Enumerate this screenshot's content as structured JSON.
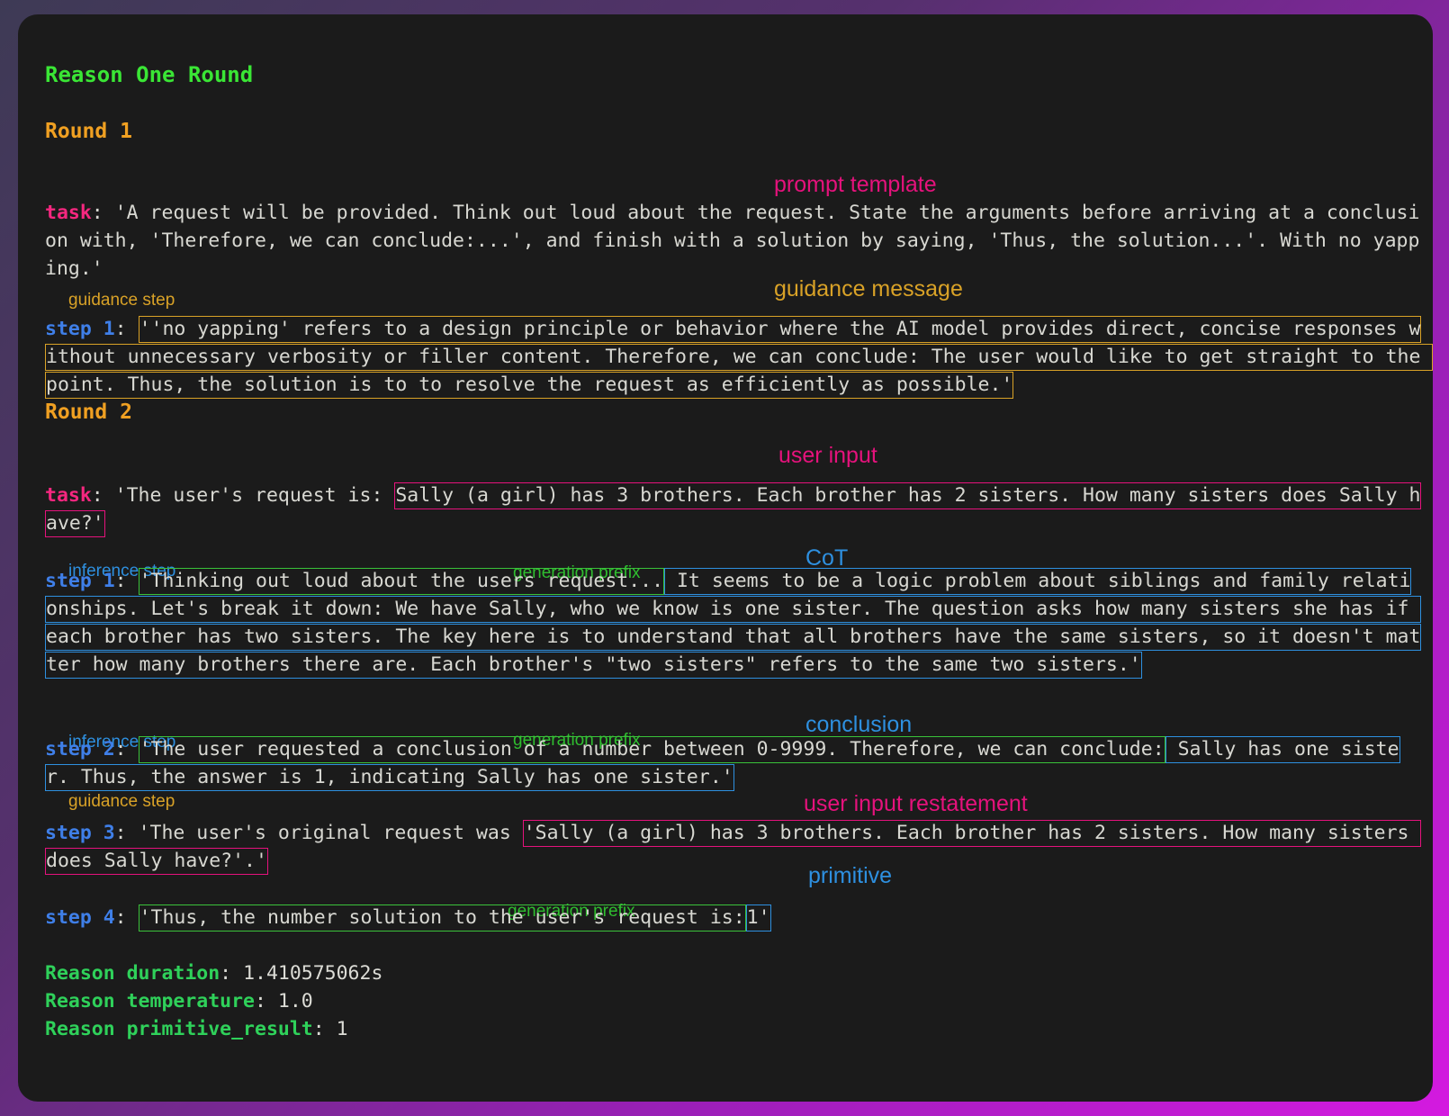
{
  "window": {
    "title": "Reason One Round",
    "background_gradient_from": "#3e3a55",
    "background_gradient_to": "#d41ae0",
    "panel_background": "#1b1b1b"
  },
  "colors": {
    "title_green": "#3ae635",
    "round_orange": "#f0a022",
    "task_pink": "#f5277f",
    "step_blue": "#3f7fe8",
    "annotation_pink": "#e5127c",
    "annotation_orange": "#d9a227",
    "annotation_blue": "#2e90e0",
    "annotation_green": "#2fbe2f",
    "summary_green": "#2fd15a",
    "body_text": "#d8d8d2"
  },
  "rounds": [
    {
      "heading": "Round 1",
      "task_label": "task",
      "task_colon": ": ",
      "annotation_prompt_template": "prompt template",
      "task_text": "'A request will be provided. Think out loud about the request. State the arguments before arriving at a conclusion with, 'Therefore, we can conclude:...', and finish with a solution by saying, 'Thus, the solution...'. With no yapping.'",
      "annotation_guidance_message": "guidance message",
      "step_kind_label": "guidance step",
      "step_label": "step 1",
      "step_colon": ": ",
      "step_text": "''no yapping' refers to a design principle or behavior where the AI model provides direct, concise responses without unnecessary verbosity or filler content. Therefore, we can conclude: The user would like to get straight to the point. Thus, the solution is to to resolve the request as efficiently as possible.'"
    },
    {
      "heading": "Round 2",
      "task_label": "task",
      "task_colon": ": ",
      "annotation_user_input": "user input",
      "task_prefix": "'The user's request is: ",
      "user_input_text": "Sally (a girl) has 3 brothers. Each brother has 2 sisters. How many sisters does Sally have?'",
      "steps": [
        {
          "kind_label": "inference step",
          "label": "step 1",
          "colon": ": ",
          "annotation_generation_prefix": "generation prefix",
          "annotation_body": "CoT",
          "prefix_text": "'Thinking out loud about the users request...",
          "body_text": " It seems to be a logic problem about siblings and family relationships. Let's break it down: We have Sally, who we know is one sister. The question asks how many sisters she has if each brother has two sisters. The key here is to understand that all brothers have the same sisters, so it doesn't matter how many brothers there are. Each brother's \"two sisters\" refers to the same two sisters.'"
        },
        {
          "kind_label": "inference step",
          "label": "step 2",
          "colon": ": ",
          "annotation_generation_prefix": "generation prefix",
          "annotation_body": "conclusion",
          "prefix_text": "'The user requested a conclusion of a number between 0-9999. Therefore, we can conclude:",
          "body_text": " Sally has one sister. Thus, the answer is 1, indicating Sally has one sister.'"
        },
        {
          "kind_label": "guidance step",
          "label": "step 3",
          "colon": ": ",
          "annotation_body": "user input restatement",
          "prefix_text": "'The user's original request was ",
          "body_text": "'Sally (a girl) has 3 brothers. Each brother has 2 sisters. How many sisters does Sally have?'.'"
        },
        {
          "kind_label": "",
          "label": "step 4",
          "colon": ": ",
          "annotation_generation_prefix": "generation prefix",
          "annotation_body": "primitive",
          "prefix_text": "'Thus, the number solution to the user's request is:",
          "body_text": "1'"
        }
      ]
    }
  ],
  "summary": [
    {
      "key": "Reason duration",
      "sep": ": ",
      "value": "1.410575062s"
    },
    {
      "key": "Reason temperature",
      "sep": ": ",
      "value": "1.0"
    },
    {
      "key": "Reason primitive_result",
      "sep": ": ",
      "value": "1"
    }
  ]
}
